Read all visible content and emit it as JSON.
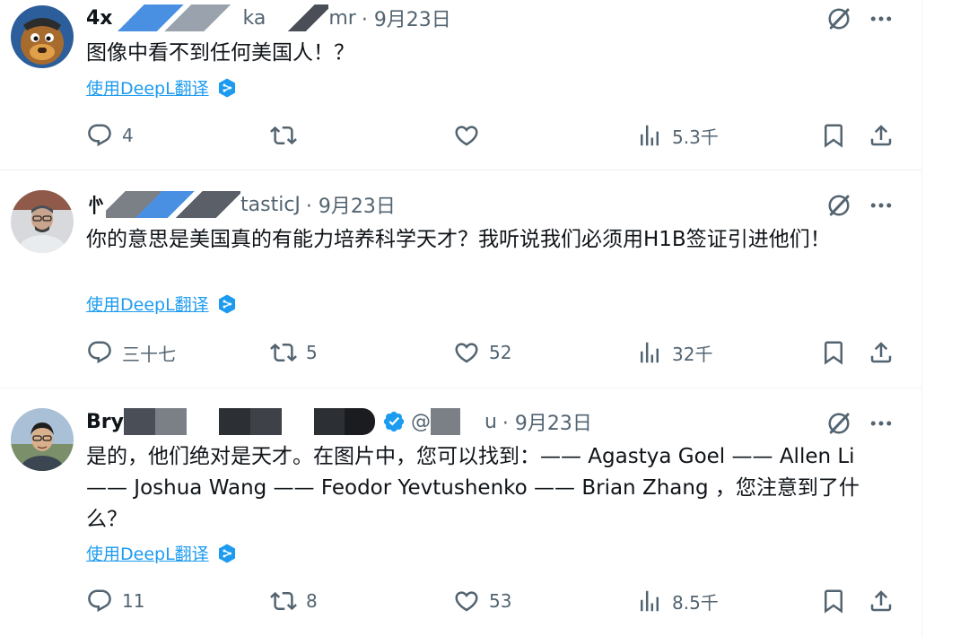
{
  "tweets": [
    {
      "display_name": "4x",
      "handle_fragment": "ka",
      "handle_fragment2": "mr",
      "date": "· 9月23日",
      "text": "图像中看不到任何美国人！？",
      "translate_label": "使用DeepL翻译",
      "actions": {
        "replies": "4",
        "reposts": "",
        "likes": "",
        "views": "5.3千"
      },
      "avatar_colors": {
        "bg": "#2b5e9a",
        "accent": "#e0a04a"
      }
    },
    {
      "display_name": "㣺",
      "handle_fragment": "tasticJ",
      "date": "· 9月23日",
      "text": "你的意思是美国真的有能力培养科学天才？我听说我们必须用H1B签证引进他们！",
      "translate_label": "使用DeepL翻译",
      "actions": {
        "replies": "三十七",
        "reposts": "5",
        "likes": "52",
        "views": "32千"
      },
      "avatar_colors": {
        "bg": "#b8bcc2",
        "accent": "#4a4f57"
      }
    },
    {
      "display_name": "Bry",
      "handle_fragment": "@",
      "handle_fragment2": "u",
      "date": "· 9月23日",
      "verified": true,
      "text": "是的，他们绝对是天才。在图片中，您可以找到：—— Agastya Goel —— Allen Li —— Joshua Wang —— Feodor Yevtushenko —— Brian Zhang ，您注意到了什么？",
      "translate_label": "使用DeepL翻译",
      "actions": {
        "replies": "11",
        "reposts": "8",
        "likes": "53",
        "views": "8.5千"
      },
      "avatar_colors": {
        "bg": "#7a8f6a",
        "accent": "#2c2c2c"
      }
    }
  ],
  "colors": {
    "text": "#0f1419",
    "muted": "#536471",
    "link": "#1d9bf0",
    "divider": "#eff3f4",
    "verified": "#1d9bf0"
  },
  "icons": [
    "reply-icon",
    "repost-icon",
    "like-icon",
    "views-icon",
    "bookmark-icon",
    "share-icon",
    "grok-icon",
    "more-icon",
    "deepl-icon",
    "verified-icon"
  ]
}
